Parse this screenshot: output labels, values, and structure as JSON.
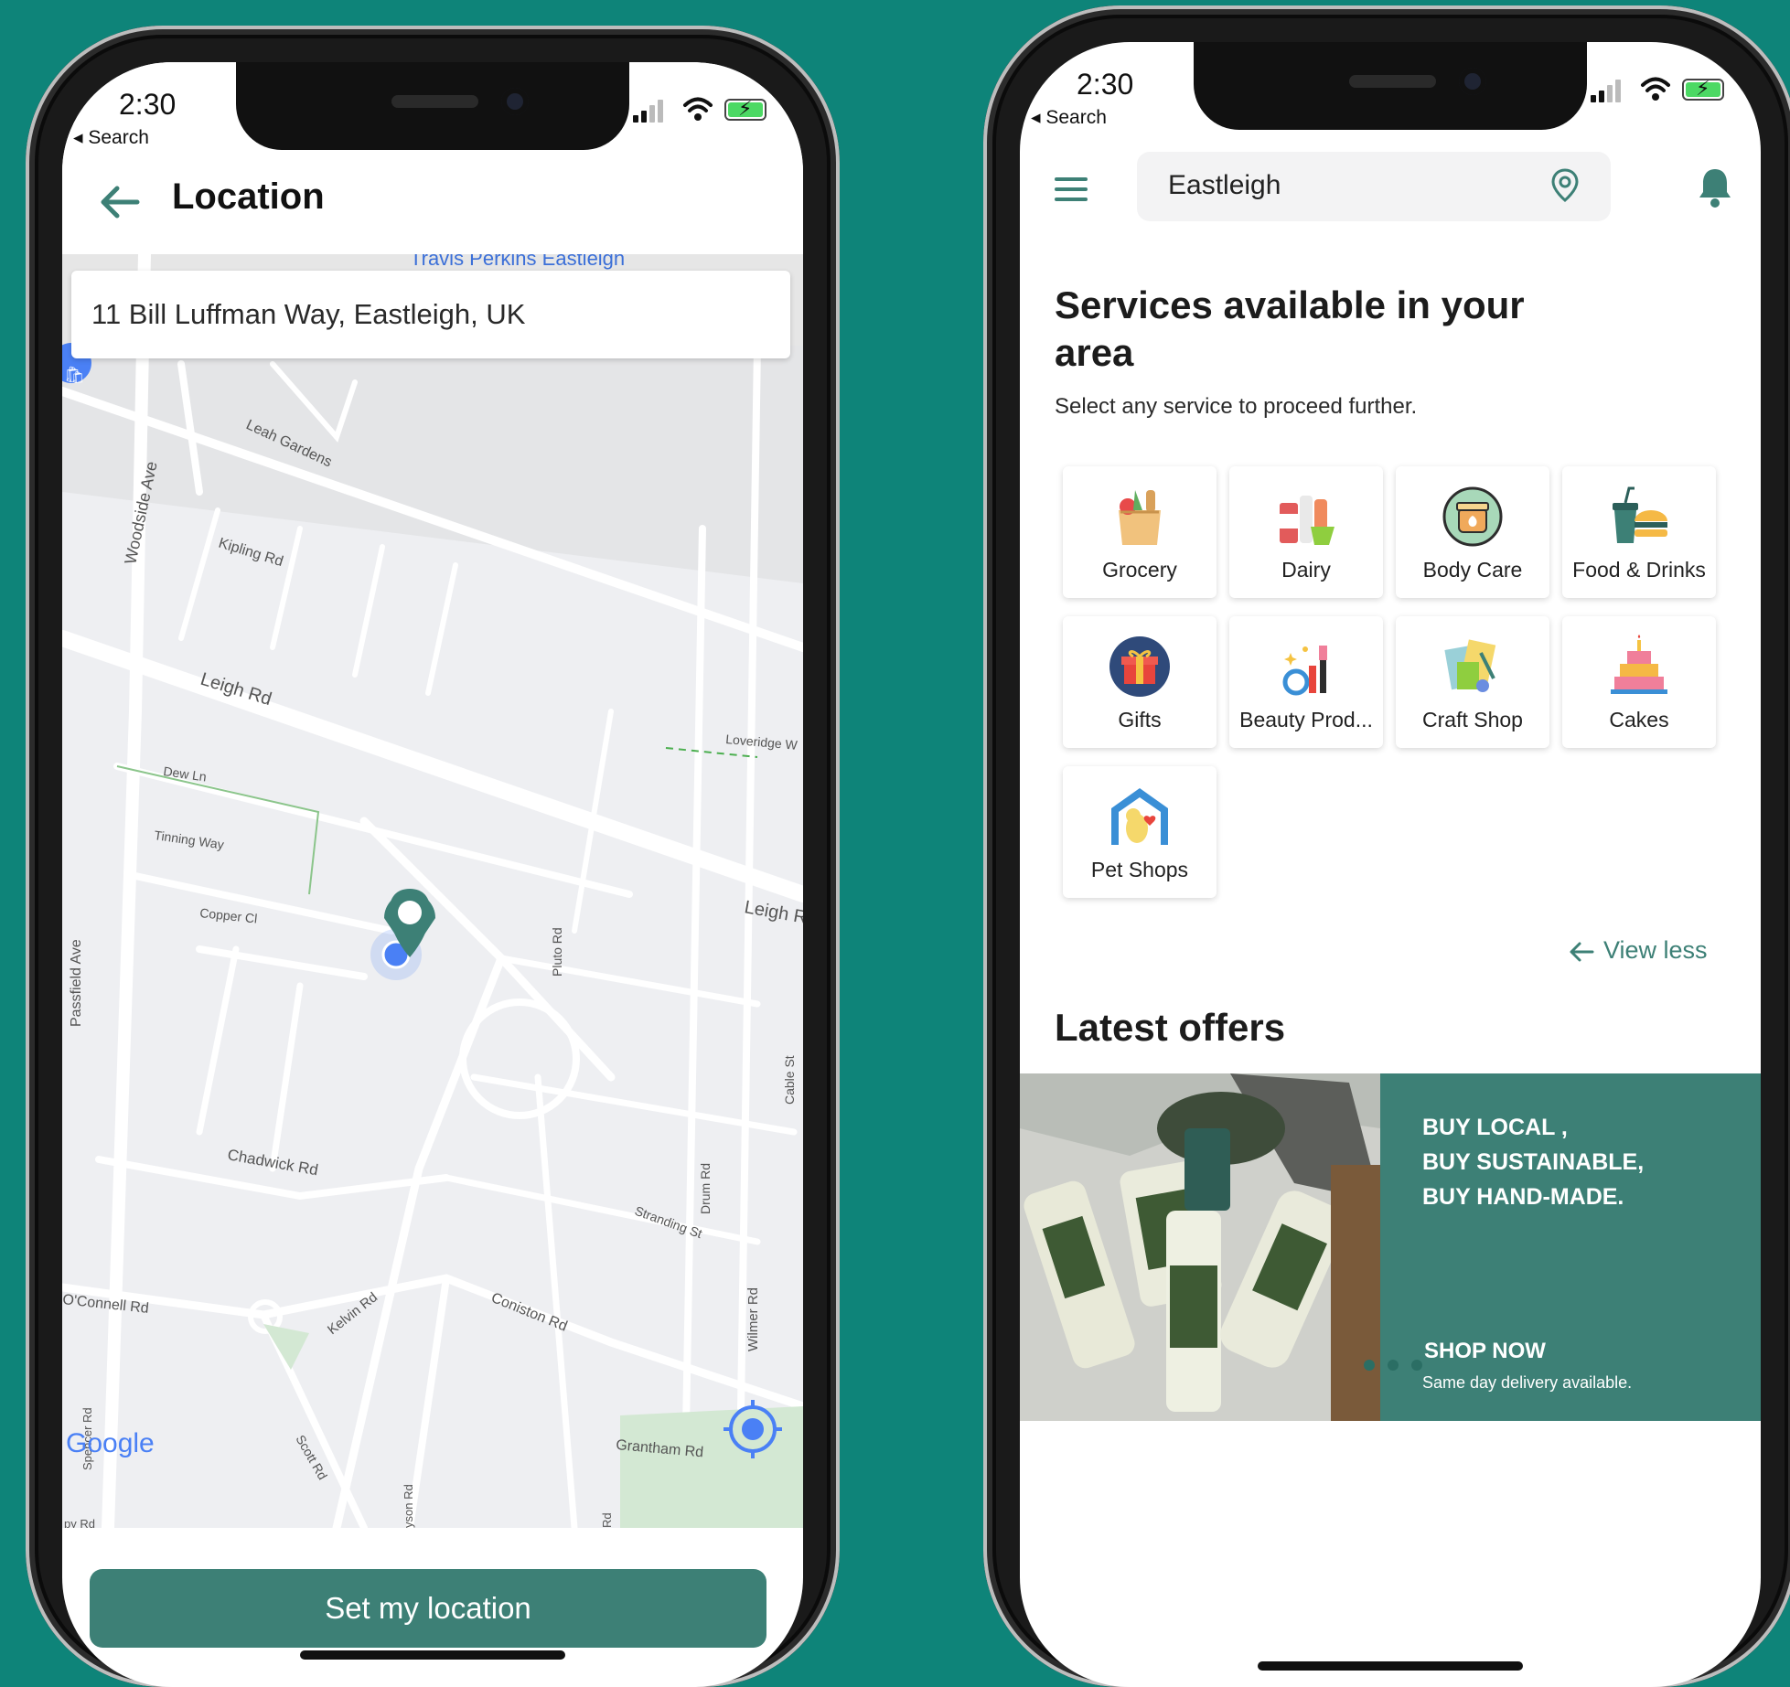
{
  "left_screen": {
    "status": {
      "time": "2:30",
      "back_label": "◂ Search"
    },
    "header": {
      "title": "Location"
    },
    "address": "11 Bill Luffman Way, Eastleigh, UK",
    "map": {
      "streets": [
        "Travis Perkins Eastleigh",
        "Leah Gardens",
        "Woodside Ave",
        "Kipling Rd",
        "Leigh Rd",
        "Loveridge W",
        "Dew Ln",
        "Tinning Way",
        "Leigh R",
        "Copper Cl",
        "Pluto Rd",
        "Passfield Ave",
        "Cable St",
        "Chadwick Rd",
        "Drum Rd",
        "Stranding St",
        "O'Connell Rd",
        "Kelvin Rd",
        "Coniston Rd",
        "Wilmer Rd",
        "Spencer Rd",
        "Scott Rd",
        "Grantham Rd",
        "yson Rd",
        "Rd",
        "py Rd"
      ],
      "attribution": "Google"
    },
    "button": "Set my location"
  },
  "right_screen": {
    "status": {
      "time": "2:30",
      "back_label": "◂ Search"
    },
    "search": {
      "value": "Eastleigh"
    },
    "services": {
      "heading": "Services available in your area",
      "subtitle": "Select any service to proceed further.",
      "items": [
        {
          "label": "Grocery",
          "icon": "grocery-bag-icon"
        },
        {
          "label": "Dairy",
          "icon": "dairy-bottles-icon"
        },
        {
          "label": "Body Care",
          "icon": "body-care-jar-icon"
        },
        {
          "label": "Food & Drinks",
          "icon": "food-drinks-icon"
        },
        {
          "label": "Gifts",
          "icon": "gift-box-icon"
        },
        {
          "label": "Beauty Prod...",
          "icon": "beauty-products-icon"
        },
        {
          "label": "Craft Shop",
          "icon": "craft-supplies-icon"
        },
        {
          "label": "Cakes",
          "icon": "cake-icon"
        },
        {
          "label": "Pet Shops",
          "icon": "pet-house-icon"
        }
      ],
      "view_less": "View less"
    },
    "offers": {
      "title": "Latest offers",
      "banner_heading": "BUY LOCAL ,\nBUY SUSTAINABLE,\nBUY HAND-MADE.",
      "banner_lines": [
        "BUY LOCAL ,",
        "BUY SUSTAINABLE,",
        "BUY HAND-MADE."
      ],
      "cta": "SHOP NOW",
      "cta_sub": "Same day delivery available.",
      "slide_count": 3
    }
  },
  "colors": {
    "background": "#0e8479",
    "accent": "#3d8076",
    "map_bg": "#eeeff2",
    "user_dot": "#4a80f5"
  }
}
